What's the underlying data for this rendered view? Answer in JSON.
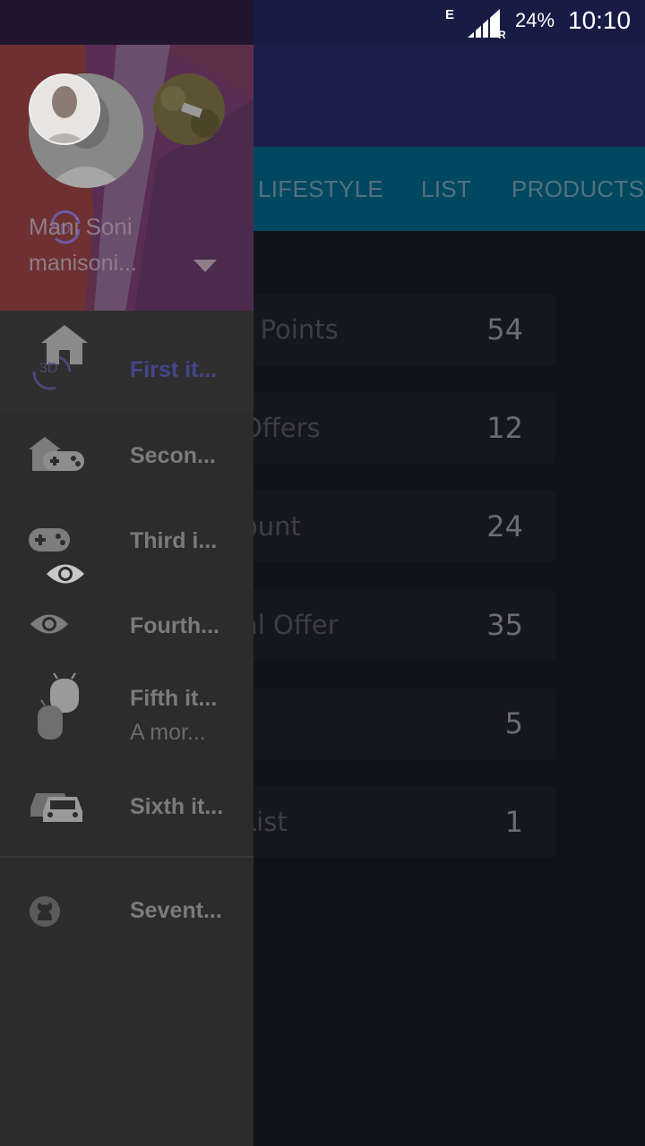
{
  "status_bar": {
    "network": "E",
    "signal_badge": "R",
    "battery": "24%",
    "time": "10:10"
  },
  "app": {
    "tabs": [
      {
        "label": "LIFESTYLE"
      },
      {
        "label": "LIST"
      },
      {
        "label": "PRODUCTS"
      }
    ],
    "cards": [
      {
        "label": "t Points",
        "value": "54"
      },
      {
        "label": "Offers",
        "value": "12"
      },
      {
        "label": "ount",
        "value": "24"
      },
      {
        "label": "al Offer",
        "value": "35"
      },
      {
        "label": "",
        "value": "5"
      },
      {
        "label": "List",
        "value": "1"
      }
    ]
  },
  "drawer": {
    "profile": {
      "name": "Mani Soni",
      "email": "manisoni...",
      "badge": "3D"
    },
    "items": [
      {
        "label": "First it...",
        "icon": "home-icon",
        "selected": true,
        "badge": "3D"
      },
      {
        "label": "Secon...",
        "icon": "home-gamepad-icon"
      },
      {
        "label": "Third i...",
        "icon": "gamepad-icon"
      },
      {
        "label": "Fourth...",
        "icon": "eye-icon"
      },
      {
        "label": "Fifth it...",
        "description": "A mor...",
        "icon": "android-icon"
      },
      {
        "label": "Sixth it...",
        "icon": "car-icon"
      },
      {
        "label": "Sevent...",
        "icon": "github-icon"
      }
    ]
  },
  "colors": {
    "drawer_bg": "#2c2c2c",
    "header_bg": "#5e2f4a",
    "selected_text": "#43468a",
    "tab_bar": "#00485f",
    "toolbar": "#1a1f4a"
  }
}
